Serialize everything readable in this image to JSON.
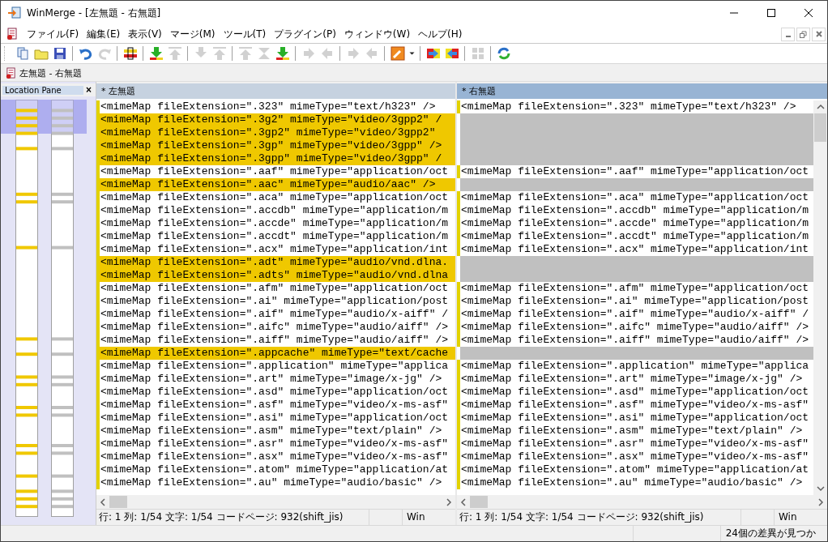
{
  "window": {
    "title": "WinMerge - [左無題 - 右無題]"
  },
  "menu": [
    "ファイル(F)",
    "編集(E)",
    "表示(V)",
    "マージ(M)",
    "ツール(T)",
    "プラグイン(P)",
    "ウィンドウ(W)",
    "ヘルプ(H)"
  ],
  "toolbar": [
    [
      {
        "kind": "new",
        "disabled": false
      },
      {
        "kind": "open",
        "disabled": false
      },
      {
        "kind": "save",
        "disabled": false
      }
    ],
    [
      {
        "kind": "undo",
        "disabled": false
      },
      {
        "kind": "redo",
        "disabled": true
      }
    ],
    [
      {
        "kind": "options",
        "disabled": false
      }
    ],
    [
      {
        "kind": "down",
        "disabled": false
      },
      {
        "kind": "up",
        "disabled": true
      }
    ],
    [
      {
        "kind": "down",
        "disabled": true
      },
      {
        "kind": "up",
        "disabled": true
      }
    ],
    [
      {
        "kind": "first",
        "disabled": true
      },
      {
        "kind": "current",
        "disabled": true
      },
      {
        "kind": "last",
        "disabled": false
      }
    ],
    [
      {
        "kind": "right",
        "disabled": true
      },
      {
        "kind": "left",
        "disabled": true
      }
    ],
    [
      {
        "kind": "right",
        "disabled": true
      },
      {
        "kind": "left",
        "disabled": true
      }
    ],
    [
      {
        "kind": "wrench",
        "disabled": false
      },
      {
        "kind": "caret",
        "disabled": false
      }
    ],
    [
      {
        "kind": "copy-right",
        "disabled": false
      },
      {
        "kind": "copy-left",
        "disabled": false
      }
    ],
    [
      {
        "kind": "grid",
        "disabled": true
      }
    ],
    [
      {
        "kind": "refresh",
        "disabled": false
      }
    ]
  ],
  "tab": {
    "label": "左無題 - 右無題"
  },
  "location_pane": {
    "title": "Location Pane",
    "close": "×"
  },
  "panes": [
    {
      "title": "* 左無題",
      "active": false
    },
    {
      "title": "* 右無題",
      "active": true
    }
  ],
  "rows": [
    {
      "kind": "same",
      "left": "<mimeMap fileExtension=\".323\" mimeType=\"text/h323\" />",
      "right": "<mimeMap fileExtension=\".323\" mimeType=\"text/h323\" />"
    },
    {
      "kind": "left-only",
      "left": "<mimeMap fileExtension=\".3g2\" mimeType=\"video/3gpp2\" /"
    },
    {
      "kind": "left-only",
      "left": "<mimeMap fileExtension=\".3gp2\" mimeType=\"video/3gpp2\""
    },
    {
      "kind": "left-only",
      "left": "<mimeMap fileExtension=\".3gp\" mimeType=\"video/3gpp\" />"
    },
    {
      "kind": "left-only",
      "left": "<mimeMap fileExtension=\".3gpp\" mimeType=\"video/3gpp\" /"
    },
    {
      "kind": "same",
      "left": "<mimeMap fileExtension=\".aaf\" mimeType=\"application/oct",
      "right": "<mimeMap fileExtension=\".aaf\" mimeType=\"application/oct"
    },
    {
      "kind": "left-only",
      "left": "<mimeMap fileExtension=\".aac\" mimeType=\"audio/aac\" />"
    },
    {
      "kind": "same",
      "left": "<mimeMap fileExtension=\".aca\" mimeType=\"application/oct",
      "right": "<mimeMap fileExtension=\".aca\" mimeType=\"application/oct"
    },
    {
      "kind": "same",
      "left": "<mimeMap fileExtension=\".accdb\" mimeType=\"application/m",
      "right": "<mimeMap fileExtension=\".accdb\" mimeType=\"application/m"
    },
    {
      "kind": "same",
      "left": "<mimeMap fileExtension=\".accde\" mimeType=\"application/m",
      "right": "<mimeMap fileExtension=\".accde\" mimeType=\"application/m"
    },
    {
      "kind": "same",
      "left": "<mimeMap fileExtension=\".accdt\" mimeType=\"application/m",
      "right": "<mimeMap fileExtension=\".accdt\" mimeType=\"application/m"
    },
    {
      "kind": "same",
      "left": "<mimeMap fileExtension=\".acx\" mimeType=\"application/int",
      "right": "<mimeMap fileExtension=\".acx\" mimeType=\"application/int"
    },
    {
      "kind": "left-only",
      "left": "<mimeMap fileExtension=\".adt\" mimeType=\"audio/vnd.dlna."
    },
    {
      "kind": "left-only",
      "left": "<mimeMap fileExtension=\".adts\" mimeType=\"audio/vnd.dlna"
    },
    {
      "kind": "same",
      "left": "<mimeMap fileExtension=\".afm\" mimeType=\"application/oct",
      "right": "<mimeMap fileExtension=\".afm\" mimeType=\"application/oct"
    },
    {
      "kind": "same",
      "left": "<mimeMap fileExtension=\".ai\" mimeType=\"application/post",
      "right": "<mimeMap fileExtension=\".ai\" mimeType=\"application/post"
    },
    {
      "kind": "same",
      "left": "<mimeMap fileExtension=\".aif\" mimeType=\"audio/x-aiff\" /",
      "right": "<mimeMap fileExtension=\".aif\" mimeType=\"audio/x-aiff\" /"
    },
    {
      "kind": "same",
      "left": "<mimeMap fileExtension=\".aifc\" mimeType=\"audio/aiff\" />",
      "right": "<mimeMap fileExtension=\".aifc\" mimeType=\"audio/aiff\" />"
    },
    {
      "kind": "same",
      "left": "<mimeMap fileExtension=\".aiff\" mimeType=\"audio/aiff\" />",
      "right": "<mimeMap fileExtension=\".aiff\" mimeType=\"audio/aiff\" />"
    },
    {
      "kind": "left-only",
      "left": "<mimeMap fileExtension=\".appcache\" mimeType=\"text/cache"
    },
    {
      "kind": "same",
      "left": "<mimeMap fileExtension=\".application\" mimeType=\"applica",
      "right": "<mimeMap fileExtension=\".application\" mimeType=\"applica"
    },
    {
      "kind": "same",
      "left": "<mimeMap fileExtension=\".art\" mimeType=\"image/x-jg\" />",
      "right": "<mimeMap fileExtension=\".art\" mimeType=\"image/x-jg\" />"
    },
    {
      "kind": "same",
      "left": "<mimeMap fileExtension=\".asd\" mimeType=\"application/oct",
      "right": "<mimeMap fileExtension=\".asd\" mimeType=\"application/oct"
    },
    {
      "kind": "same",
      "left": "<mimeMap fileExtension=\".asf\" mimeType=\"video/x-ms-asf\"",
      "right": "<mimeMap fileExtension=\".asf\" mimeType=\"video/x-ms-asf\""
    },
    {
      "kind": "same",
      "left": "<mimeMap fileExtension=\".asi\" mimeType=\"application/oct",
      "right": "<mimeMap fileExtension=\".asi\" mimeType=\"application/oct"
    },
    {
      "kind": "same",
      "left": "<mimeMap fileExtension=\".asm\" mimeType=\"text/plain\" />",
      "right": "<mimeMap fileExtension=\".asm\" mimeType=\"text/plain\" />"
    },
    {
      "kind": "same",
      "left": "<mimeMap fileExtension=\".asr\" mimeType=\"video/x-ms-asf\"",
      "right": "<mimeMap fileExtension=\".asr\" mimeType=\"video/x-ms-asf\""
    },
    {
      "kind": "same",
      "left": "<mimeMap fileExtension=\".asx\" mimeType=\"video/x-ms-asf\"",
      "right": "<mimeMap fileExtension=\".asx\" mimeType=\"video/x-ms-asf\""
    },
    {
      "kind": "same",
      "left": "<mimeMap fileExtension=\".atom\" mimeType=\"application/at",
      "right": "<mimeMap fileExtension=\".atom\" mimeType=\"application/at"
    },
    {
      "kind": "same",
      "left": "<mimeMap fileExtension=\".au\" mimeType=\"audio/basic\" />",
      "right": "<mimeMap fileExtension=\".au\" mimeType=\"audio/basic\" />"
    }
  ],
  "pane_status": [
    {
      "position": "行: 1 列: 1/54 文字: 1/54 コードページ: 932(shift_jis)",
      "eol": "Win"
    },
    {
      "position": "行: 1 列: 1/54 文字: 1/54 コードページ: 932(shift_jis)",
      "eol": "Win"
    }
  ],
  "status_bar": {
    "message": "24個の差異が見つか"
  }
}
